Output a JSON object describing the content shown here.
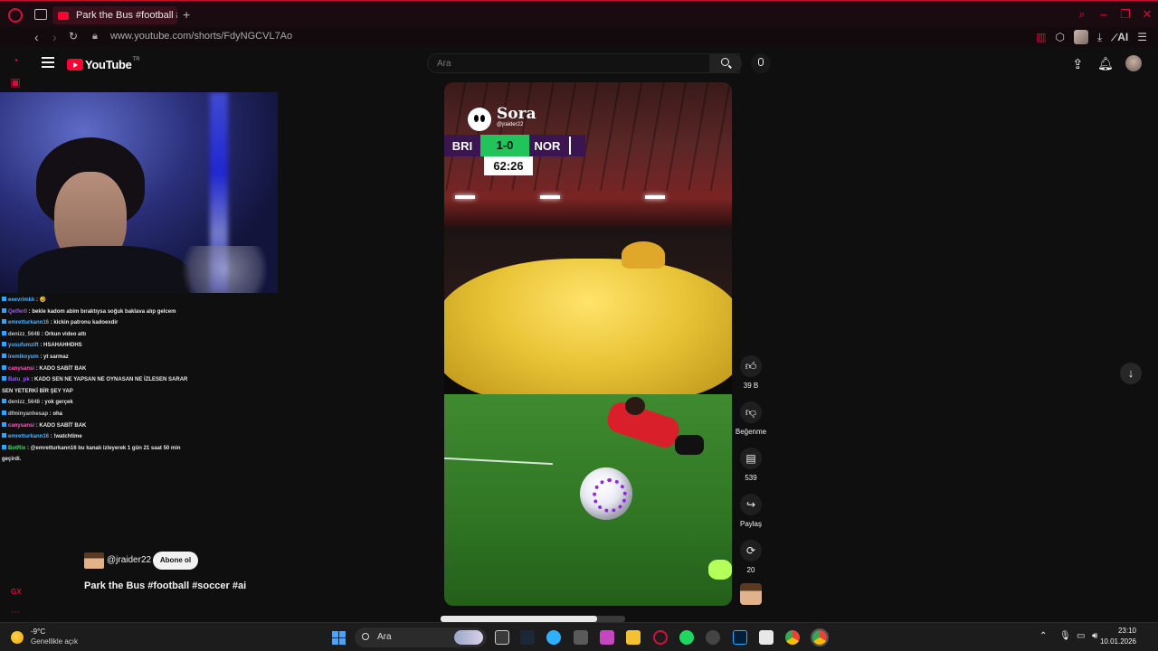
{
  "browser": {
    "tab_title": "Park the Bus #football #so",
    "new_tab": "+",
    "url": "www.youtube.com/shorts/FdyNGCVL7Ao",
    "ai_label": "AI"
  },
  "youtube": {
    "logo_text": "YouTube",
    "region": "TR",
    "search_placeholder": "Ara"
  },
  "chat": [
    {
      "user": "eeevrimkk",
      "msg": ": 🤣",
      "cls": "u-a"
    },
    {
      "user": "Qetfer0",
      "msg": ": bekle kadom abim bıraktıysa soğuk baklava alıp gelcem",
      "cls": "u-b"
    },
    {
      "user": "emretturkann16",
      "msg": ": kickin patronu kadoexdir",
      "cls": "u-a"
    },
    {
      "user": "denizz_5648",
      "msg": ": Orkun video attı",
      "cls": "u-d"
    },
    {
      "user": "yusufumzift",
      "msg": ": HSAHAHHDHS",
      "cls": "u-a"
    },
    {
      "user": "iremlkoyum",
      "msg": ": yt sarmaz",
      "cls": "u-a"
    },
    {
      "user": "canysansi",
      "msg": ": KADO SABİT BAK",
      "cls": "u-c"
    },
    {
      "user": "Batu_pk",
      "msg": ": KADO SEN NE YAPSAN NE OYNASAN NE İZLESEN SARAR SEN YETERKİ BİR ŞEY YAP",
      "cls": "u-b"
    },
    {
      "user": "denizz_5648",
      "msg": ": yok gerçek",
      "cls": "u-d"
    },
    {
      "user": "dfminyanhesap",
      "msg": ": oha",
      "cls": "u-d"
    },
    {
      "user": "canysansi",
      "msg": ": KADO SABİT BAK",
      "cls": "u-c"
    },
    {
      "user": "emretturkann16",
      "msg": ": !watchtime",
      "cls": "u-a"
    },
    {
      "user": "BotRix",
      "msg": ": @emretturkann16 bu kanalı izleyerek 1 gün 21 saat 50 min geçirdi.",
      "cls": "u-e"
    }
  ],
  "short": {
    "channel": "@jraider22",
    "subscribe": "Abone ol",
    "title": "Park the Bus #football #soccer #ai"
  },
  "video_overlay": {
    "watermark": "Sora",
    "watermark_handle": "@jraider22",
    "home_team": "BRI",
    "score": "1-0",
    "away_team": "NOR",
    "time": "62:26"
  },
  "actions": {
    "like_count": "39 B",
    "dislike_label": "Beğenme",
    "comment_count": "539",
    "share_label": "Paylaş",
    "remix_count": "20"
  },
  "progress": 0.85,
  "taskbar": {
    "temp": "-9°C",
    "weather": "Genellikle açık",
    "search": "Ara",
    "time": "23:10",
    "date": "10.01.2026"
  }
}
